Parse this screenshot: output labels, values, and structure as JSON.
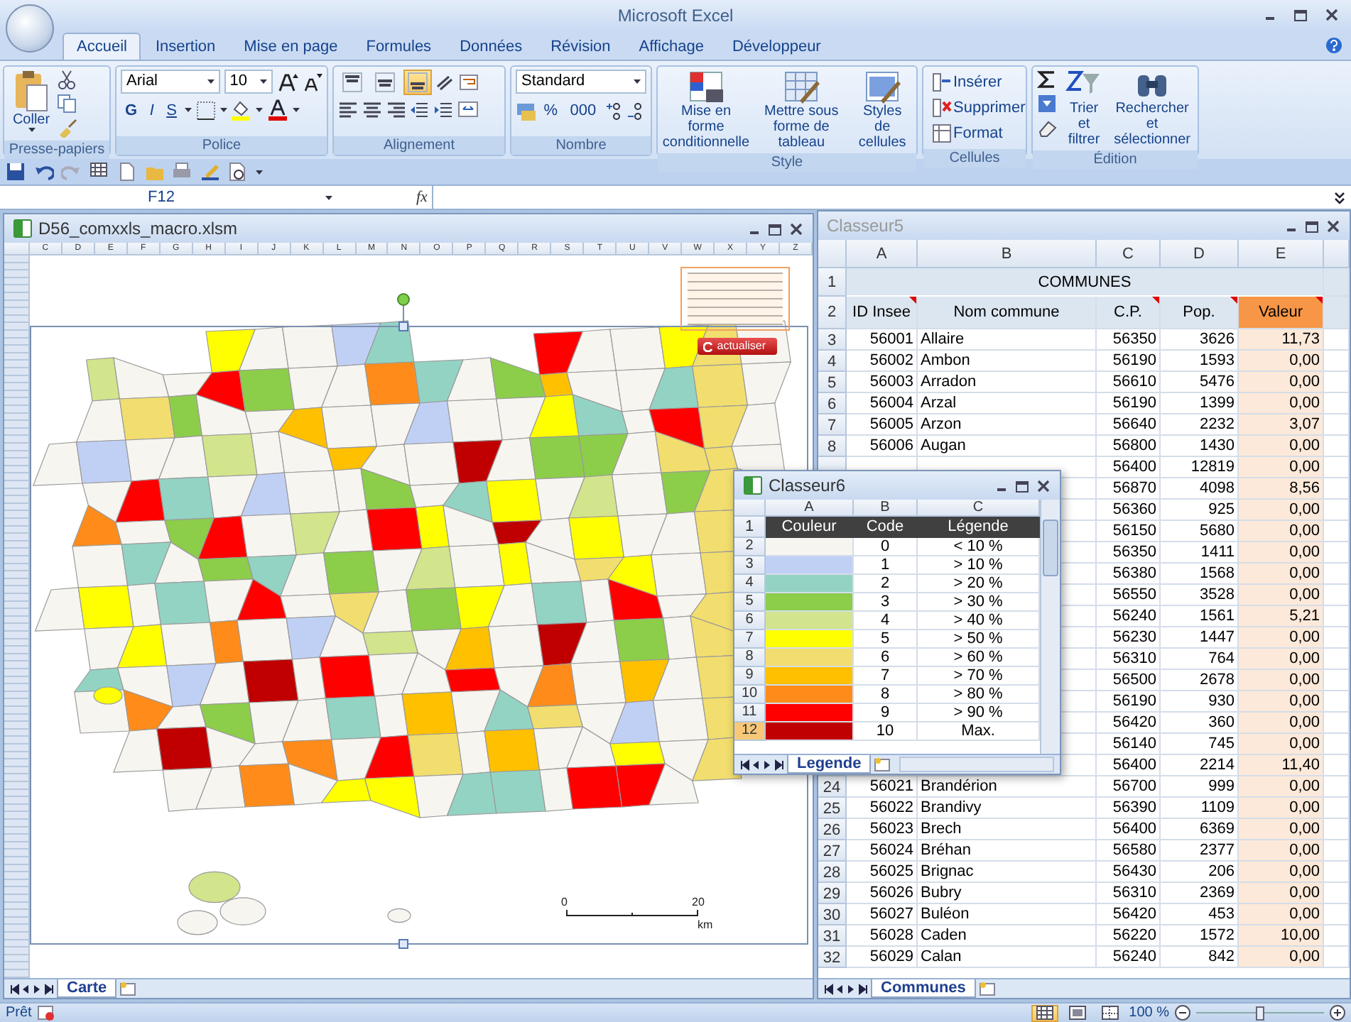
{
  "title_bar": {
    "title": "Microsoft Excel"
  },
  "ribbon_tabs": [
    {
      "label": "Accueil",
      "selected": true
    },
    {
      "label": "Insertion",
      "selected": false
    },
    {
      "label": "Mise en page",
      "selected": false
    },
    {
      "label": "Formules",
      "selected": false
    },
    {
      "label": "Données",
      "selected": false
    },
    {
      "label": "Révision",
      "selected": false
    },
    {
      "label": "Affichage",
      "selected": false
    },
    {
      "label": "Développeur",
      "selected": false
    }
  ],
  "ribbon": {
    "clipboard": {
      "paste_label": "Coller",
      "group_label": "Presse-papiers"
    },
    "font": {
      "font_name": "Arial",
      "font_size": "10",
      "bold_label": "G",
      "italic_label": "I",
      "underline_label": "S",
      "group_label": "Police"
    },
    "alignment": {
      "vertical_buttons": [
        {
          "selected": false
        },
        {
          "selected": false
        },
        {
          "selected": true
        }
      ],
      "group_label": "Alignement"
    },
    "number": {
      "format": "Standard",
      "percent_label": "%",
      "thousands_label": "000",
      "group_label": "Nombre"
    },
    "style": {
      "buttons": [
        "Mise en forme conditionnelle",
        "Mettre sous forme de tableau",
        "Styles de cellules"
      ],
      "group_label": "Style"
    },
    "cells": {
      "buttons": [
        "Insérer",
        "Supprimer",
        "Format"
      ],
      "group_label": "Cellules"
    },
    "editing": {
      "buttons": [
        "Trier et filtrer",
        "Rechercher et sélectionner"
      ],
      "group_label": "Édition"
    }
  },
  "formula_bar": {
    "name_box": "F12",
    "function_label": "fx"
  },
  "map_window": {
    "title": "D56_comxxls_macro.xlsm",
    "columns": [
      "C",
      "D",
      "E",
      "F",
      "G",
      "H",
      "I",
      "J",
      "K",
      "L",
      "M",
      "N",
      "O",
      "P",
      "Q",
      "R",
      "S",
      "T",
      "U",
      "V",
      "W",
      "X",
      "Y",
      "Z"
    ],
    "refresh_button": "actualiser",
    "scale_labels": [
      "0",
      "20",
      "km"
    ],
    "sheet_tabs": [
      {
        "label": "Carte",
        "selected": true
      }
    ]
  },
  "data_window": {
    "title": "Classeur5",
    "columns": [
      "A",
      "B",
      "C",
      "D",
      "E"
    ],
    "title_row": {
      "row": "1",
      "text": "COMMUNES"
    },
    "header_row": {
      "row": "2",
      "cells": [
        {
          "label": "ID Insee",
          "comment": true,
          "highlighted": false
        },
        {
          "label": "Nom commune",
          "comment": false,
          "highlighted": false
        },
        {
          "label": "C.P.",
          "comment": true,
          "highlighted": false
        },
        {
          "label": "Pop.",
          "comment": true,
          "highlighted": false
        },
        {
          "label": "Valeur",
          "comment": true,
          "highlighted": true
        }
      ]
    },
    "rows": [
      {
        "row": "3",
        "id": "56001",
        "name": "Allaire",
        "cp": "56350",
        "pop": "3626",
        "value": "11,73"
      },
      {
        "row": "4",
        "id": "56002",
        "name": "Ambon",
        "cp": "56190",
        "pop": "1593",
        "value": "0,00"
      },
      {
        "row": "5",
        "id": "56003",
        "name": "Arradon",
        "cp": "56610",
        "pop": "5476",
        "value": "0,00"
      },
      {
        "row": "6",
        "id": "56004",
        "name": "Arzal",
        "cp": "56190",
        "pop": "1399",
        "value": "0,00"
      },
      {
        "row": "7",
        "id": "56005",
        "name": "Arzon",
        "cp": "56640",
        "pop": "2232",
        "value": "3,07"
      },
      {
        "row": "8",
        "id": "56006",
        "name": "Augan",
        "cp": "56800",
        "pop": "1430",
        "value": "0,00"
      },
      {
        "cp": "56400",
        "pop": "12819",
        "value": "0,00"
      },
      {
        "cp": "56870",
        "pop": "4098",
        "value": "8,56"
      },
      {
        "cp": "56360",
        "pop": "925",
        "value": "0,00"
      },
      {
        "cp": "56150",
        "pop": "5680",
        "value": "0,00"
      },
      {
        "cp": "56350",
        "pop": "1411",
        "value": "0,00"
      },
      {
        "cp": "56380",
        "pop": "1568",
        "value": "0,00"
      },
      {
        "cp": "56550",
        "pop": "3528",
        "value": "0,00"
      },
      {
        "cp": "56240",
        "pop": "1561",
        "value": "5,21"
      },
      {
        "cp": "56230",
        "pop": "1447",
        "value": "0,00"
      },
      {
        "cp": "56310",
        "pop": "764",
        "value": "0,00"
      },
      {
        "cp": "56500",
        "pop": "2678",
        "value": "0,00"
      },
      {
        "cp": "56190",
        "pop": "930",
        "value": "0,00"
      },
      {
        "cp": "56420",
        "pop": "360",
        "value": "0,00"
      },
      {
        "cp": "56140",
        "pop": "745",
        "value": "0,00"
      },
      {
        "cp": "56400",
        "pop": "2214",
        "value": "11,40"
      },
      {
        "row": "24",
        "id": "56021",
        "name": "Brandérion",
        "cp": "56700",
        "pop": "999",
        "value": "0,00"
      },
      {
        "row": "25",
        "id": "56022",
        "name": "Brandivy",
        "cp": "56390",
        "pop": "1109",
        "value": "0,00"
      },
      {
        "row": "26",
        "id": "56023",
        "name": "Brech",
        "cp": "56400",
        "pop": "6369",
        "value": "0,00"
      },
      {
        "row": "27",
        "id": "56024",
        "name": "Bréhan",
        "cp": "56580",
        "pop": "2377",
        "value": "0,00"
      },
      {
        "row": "28",
        "id": "56025",
        "name": "Brignac",
        "cp": "56430",
        "pop": "206",
        "value": "0,00"
      },
      {
        "row": "29",
        "id": "56026",
        "name": "Bubry",
        "cp": "56310",
        "pop": "2369",
        "value": "0,00"
      },
      {
        "row": "30",
        "id": "56027",
        "name": "Buléon",
        "cp": "56420",
        "pop": "453",
        "value": "0,00"
      },
      {
        "row": "31",
        "id": "56028",
        "name": "Caden",
        "cp": "56220",
        "pop": "1572",
        "value": "10,00"
      },
      {
        "row": "32",
        "id": "56029",
        "name": "Calan",
        "cp": "56240",
        "pop": "842",
        "value": "0,00"
      }
    ],
    "sheet_tabs": [
      {
        "label": "Communes",
        "selected": true
      }
    ]
  },
  "legend_window": {
    "title": "Classeur6",
    "columns": [
      "A",
      "B",
      "C"
    ],
    "header": {
      "row": "1",
      "cells": [
        "Couleur",
        "Code",
        "Légende"
      ]
    },
    "rows": [
      {
        "row": "2",
        "code": "0",
        "label": "< 10 %",
        "color": "#f7f5f0",
        "selected": false
      },
      {
        "row": "3",
        "code": "1",
        "label": "> 10 %",
        "color": "#c0d0f5",
        "selected": false
      },
      {
        "row": "4",
        "code": "2",
        "label": "> 20 %",
        "color": "#93d3c3",
        "selected": false
      },
      {
        "row": "5",
        "code": "3",
        "label": "> 30 %",
        "color": "#8ccd4a",
        "selected": false
      },
      {
        "row": "6",
        "code": "4",
        "label": "> 40 %",
        "color": "#d2e48c",
        "selected": false
      },
      {
        "row": "7",
        "code": "5",
        "label": "> 50 %",
        "color": "#ffff00",
        "selected": false
      },
      {
        "row": "8",
        "code": "6",
        "label": "> 60 %",
        "color": "#f2de6e",
        "selected": false
      },
      {
        "row": "9",
        "code": "7",
        "label": "> 70 %",
        "color": "#ffc000",
        "selected": false
      },
      {
        "row": "10",
        "code": "8",
        "label": "> 80 %",
        "color": "#ff8c1a",
        "selected": false
      },
      {
        "row": "11",
        "code": "9",
        "label": "> 90 %",
        "color": "#ff0000",
        "selected": false
      },
      {
        "row": "12",
        "code": "10",
        "label": "Max.",
        "color": "#c00000",
        "selected": true
      }
    ],
    "sheet_tabs": [
      {
        "label": "Legende",
        "selected": true
      }
    ]
  },
  "status_bar": {
    "state": "Prêt",
    "view_buttons": [
      {
        "selected": true
      },
      {
        "selected": false
      },
      {
        "selected": false
      }
    ],
    "zoom": "100 %",
    "zoom_slider": {
      "level": 0.5
    }
  }
}
